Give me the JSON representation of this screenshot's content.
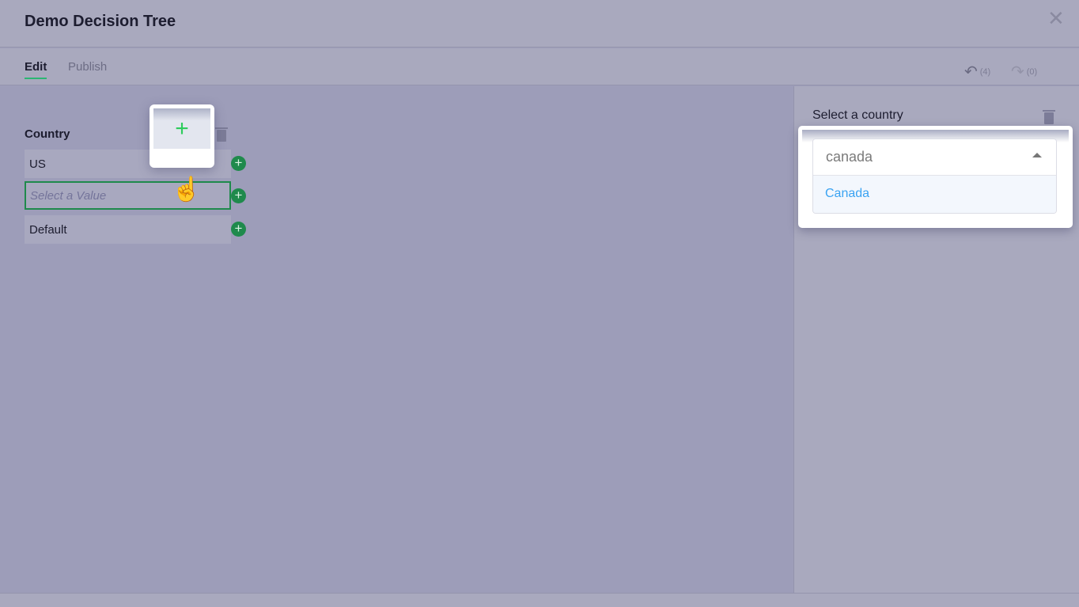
{
  "header": {
    "title": "Demo Decision Tree",
    "close_icon": "close-icon"
  },
  "tabs": [
    {
      "label": "Edit",
      "active": true
    },
    {
      "label": "Publish",
      "active": false
    }
  ],
  "history": {
    "undo_count": "(4)",
    "redo_count": "(0)"
  },
  "tree": {
    "column_title": "Country",
    "rows": [
      {
        "label": "US"
      },
      {
        "placeholder": "Select a Value"
      },
      {
        "label": "Default"
      }
    ],
    "drag_plus": "+"
  },
  "panel": {
    "label": "Select a country",
    "search_value": "canada",
    "options": [
      "Canada"
    ]
  },
  "colors": {
    "accent": "#1f8a4c",
    "option": "#3aa3f2"
  }
}
